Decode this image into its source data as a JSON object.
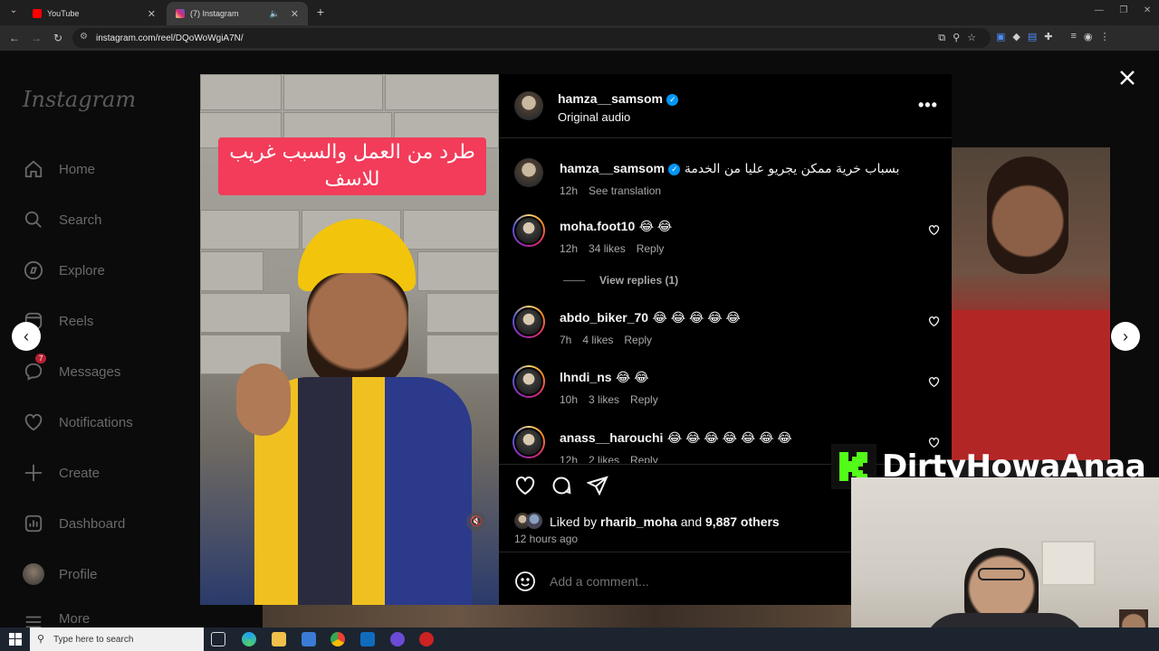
{
  "browser": {
    "tabs": [
      {
        "title": "YouTube",
        "icon": "youtube-icon",
        "color": "#ff0000"
      },
      {
        "title": "(7) Instagram",
        "icon": "instagram-icon",
        "color": "#d62976"
      }
    ],
    "url": "instagram.com/reel/DQoWoWgiA7N/"
  },
  "sidebar": {
    "logo": "Instagram",
    "items": [
      {
        "label": "Home",
        "icon": "home-icon"
      },
      {
        "label": "Search",
        "icon": "search-icon"
      },
      {
        "label": "Explore",
        "icon": "compass-icon"
      },
      {
        "label": "Reels",
        "icon": "reels-icon"
      },
      {
        "label": "Messages",
        "icon": "messenger-icon",
        "badge": "7"
      },
      {
        "label": "Notifications",
        "icon": "heart-icon"
      },
      {
        "label": "Create",
        "icon": "plus-icon"
      },
      {
        "label": "Dashboard",
        "icon": "dashboard-icon"
      },
      {
        "label": "Profile",
        "icon": "avatar"
      },
      {
        "label": "More",
        "icon": "menu-icon"
      }
    ]
  },
  "video": {
    "overlay_text": "طرد من العمل والسبب غريب للاسف"
  },
  "post": {
    "author": "hamza__samsom",
    "audio": "Original audio",
    "caption": {
      "username": "hamza__samsom",
      "text": "بسباب خرية ممكن يجريو عليا من الخدمة",
      "time": "12h",
      "translate": "See translation"
    },
    "comments": [
      {
        "username": "moha.foot10",
        "text": "😂 😂",
        "time": "12h",
        "likes": "34 likes",
        "reply": "Reply",
        "view_replies": "View replies (1)"
      },
      {
        "username": "abdo_biker_70",
        "text": "😂 😂 😂 😂 😂",
        "time": "7h",
        "likes": "4 likes",
        "reply": "Reply"
      },
      {
        "username": "lhndi_ns",
        "text": "😂 😂",
        "time": "10h",
        "likes": "3 likes",
        "reply": "Reply"
      },
      {
        "username": "anass__harouchi",
        "text": "😂 😂 😂 😂 😂 😂 😂",
        "time": "12h",
        "likes": "2 likes",
        "reply": "Reply"
      }
    ],
    "liked_by_prefix": "Liked by",
    "liked_by_user": "rharib_moha",
    "liked_by_suffix": "and",
    "liked_by_others": "9,887 others",
    "posted": "12 hours ago",
    "add_comment_placeholder": "Add a comment..."
  },
  "stream": {
    "watermark": "DirtyHowaAnaa"
  },
  "taskbar": {
    "search_placeholder": "Type here to search"
  },
  "colors": {
    "verified": "#0095f6",
    "badge": "#b92033",
    "banner": "#f23c5a"
  }
}
